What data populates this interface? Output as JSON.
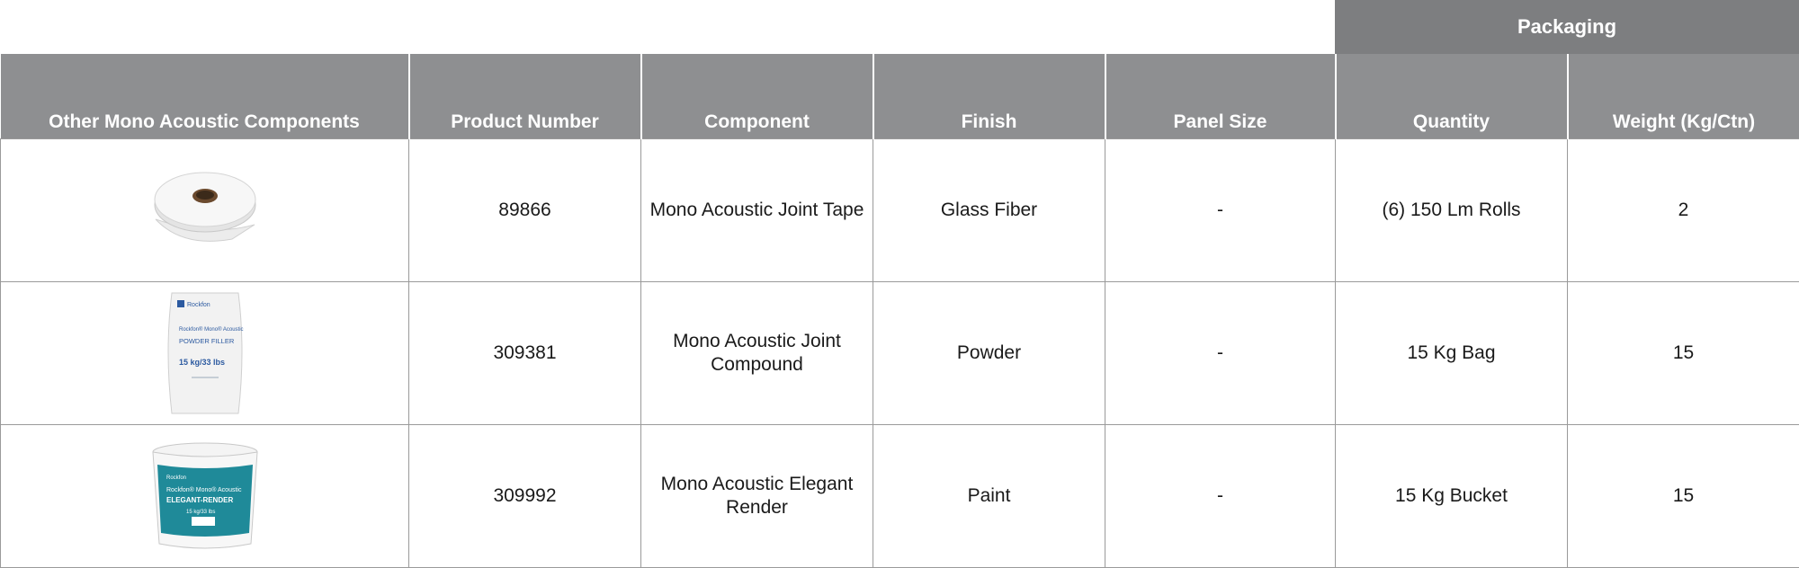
{
  "packaging_header": "Packaging",
  "columns": [
    "Other Mono Acoustic Components",
    "Product Number",
    "Component",
    "Finish",
    "Panel Size",
    "Quantity",
    "Weight (Kg/Ctn)"
  ],
  "rows": [
    {
      "image_icon": "tape-roll-icon",
      "product_number": "89866",
      "component": "Mono Acoustic Joint Tape",
      "finish": "Glass Fiber",
      "panel_size": "-",
      "quantity": "(6) 150 Lm Rolls",
      "weight": "2"
    },
    {
      "image_icon": "powder-bag-icon",
      "product_number": "309381",
      "component": "Mono Acoustic Joint Compound",
      "finish": "Powder",
      "panel_size": "-",
      "quantity": "15 Kg Bag",
      "weight": "15"
    },
    {
      "image_icon": "paint-bucket-icon",
      "product_number": "309992",
      "component": "Mono Acoustic Elegant Render",
      "finish": "Paint",
      "panel_size": "-",
      "quantity": "15 Kg Bucket",
      "weight": "15"
    }
  ],
  "product_labels": {
    "bag_brand": "Rockfon",
    "bag_line": "Rockfon® Mono® Acoustic",
    "bag_product": "POWDER FILLER",
    "bag_weight": "15 kg/33 lbs",
    "bucket_brand": "Rockfon",
    "bucket_line": "Rockfon® Mono® Acoustic",
    "bucket_product": "ELEGANT-RENDER",
    "bucket_weight": "15 kg/33 lbs"
  },
  "colors": {
    "header_bg": "#8e8f91",
    "packaging_bg": "#7d7e80",
    "bucket_teal": "#1f8a99"
  }
}
